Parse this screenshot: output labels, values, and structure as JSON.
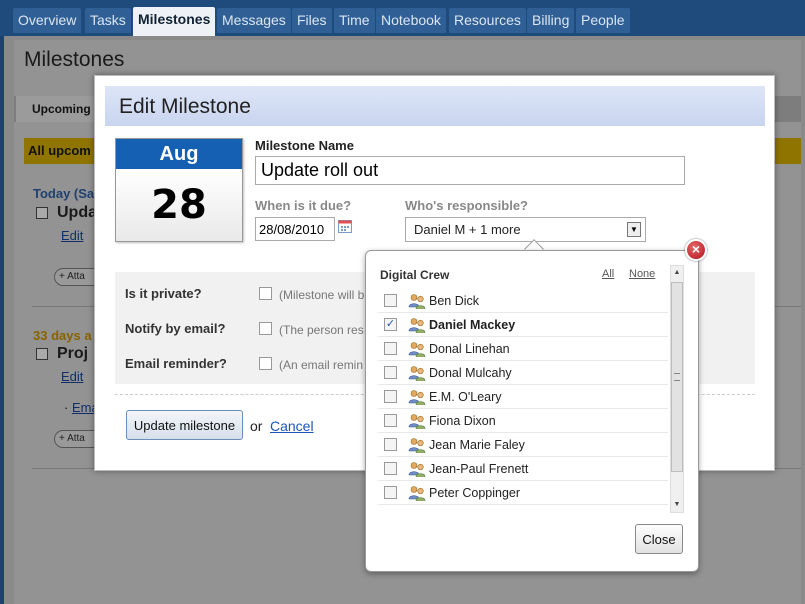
{
  "nav": {
    "tabs": [
      {
        "label": "Overview"
      },
      {
        "label": "Tasks"
      },
      {
        "label": "Milestones"
      },
      {
        "label": "Messages"
      },
      {
        "label": "Files"
      },
      {
        "label": "Time"
      },
      {
        "label": "Notebook"
      },
      {
        "label": "Resources"
      },
      {
        "label": "Billing"
      },
      {
        "label": "People"
      }
    ],
    "active": "Milestones"
  },
  "background": {
    "page_title": "Milestones",
    "tab_label": "Upcoming",
    "banner": "All upcom",
    "today_label": "Today (Sa",
    "item1": "Upda",
    "edit1": "Edit",
    "attach1": "+ Atta",
    "late_label": "33 days a",
    "item2": "Proj",
    "edit2": "Edit",
    "bullet": "Ema",
    "attach2": "+ Atta"
  },
  "modal": {
    "title": "Edit Milestone",
    "calendar": {
      "month": "Aug",
      "day": "28"
    },
    "name_label": "Milestone Name",
    "name_value": "Update roll out",
    "due_label": "When is it due?",
    "due_value": "28/08/2010",
    "who_label": "Who's responsible?",
    "who_value": "Daniel M + 1 more",
    "options": [
      {
        "label": "Is it private?",
        "desc": "(Milestone will b"
      },
      {
        "label": "Notify by email?",
        "desc": "(The person res"
      },
      {
        "label": "Email reminder?",
        "desc": "(An email remin"
      }
    ],
    "update_button": "Update milestone",
    "or_text": "or",
    "cancel_link": "Cancel"
  },
  "popup": {
    "group": "Digital Crew",
    "all_link": "All",
    "none_link": "None",
    "people": [
      {
        "name": "Ben Dick",
        "checked": false
      },
      {
        "name": "Daniel Mackey",
        "checked": true
      },
      {
        "name": "Donal Linehan",
        "checked": false
      },
      {
        "name": "Donal Mulcahy",
        "checked": false
      },
      {
        "name": "E.M. O'Leary",
        "checked": false
      },
      {
        "name": "Fiona Dixon",
        "checked": false
      },
      {
        "name": "Jean Marie Faley",
        "checked": false
      },
      {
        "name": "Jean-Paul Frenett",
        "checked": false
      },
      {
        "name": "Peter Coppinger",
        "checked": false
      }
    ],
    "close_button": "Close",
    "close_x": "×"
  },
  "icons": {
    "calendar": "calendar-icon",
    "person": "people-icon",
    "dropdown": "chevron-down-icon",
    "close": "close-icon"
  },
  "colors": {
    "nav_bg": "#1f4a7c",
    "calendar_month": "#1660b4",
    "link": "#1a56b8",
    "close_x": "#b0101a"
  }
}
